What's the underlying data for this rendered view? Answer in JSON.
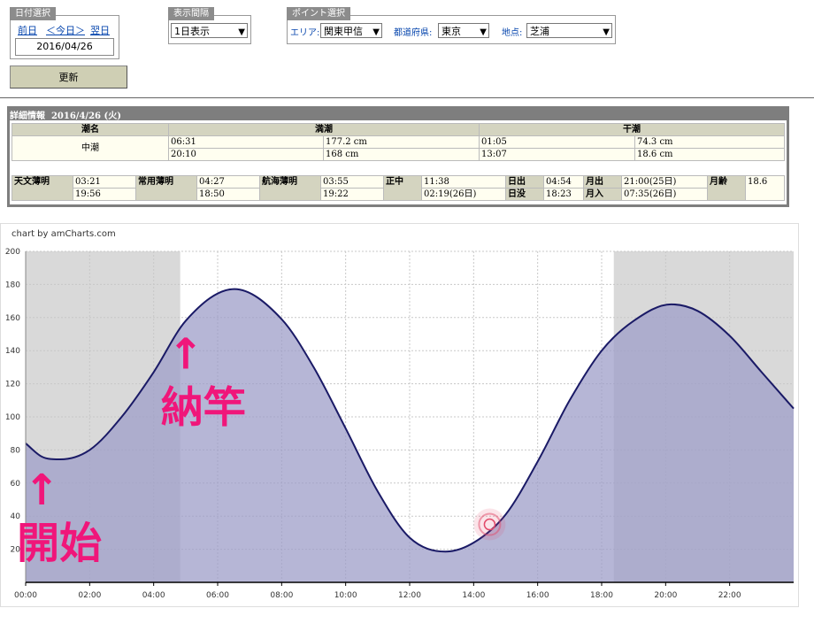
{
  "date_panel": {
    "tab": "日付選択",
    "prev": "前日",
    "today": "＜今日＞",
    "next": "翌日",
    "date": "2016/04/26"
  },
  "interval_panel": {
    "tab": "表示間隔",
    "selected": "1日表示"
  },
  "point_panel": {
    "tab": "ポイント選択",
    "area_label": "エリア:",
    "area_value": "関東甲信",
    "pref_label": "都道府県:",
    "pref_value": "東京",
    "spot_label": "地点:",
    "spot_value": "芝浦"
  },
  "update_button": "更新",
  "detail": {
    "title": "詳細情報",
    "date": "2016/4/26 (火)",
    "tide_name_header": "潮名",
    "high_header": "満潮",
    "low_header": "干潮",
    "tide_name": "中潮",
    "high": [
      {
        "time": "06:31",
        "level": "177.2 cm"
      },
      {
        "time": "20:10",
        "level": "168 cm"
      }
    ],
    "low": [
      {
        "time": "01:05",
        "level": "74.3 cm"
      },
      {
        "time": "13:07",
        "level": "18.6 cm"
      }
    ],
    "twilight": {
      "astro_label": "天文薄明",
      "astro": [
        "03:21",
        "19:56"
      ],
      "civil_label": "常用薄明",
      "civil": [
        "04:27",
        "18:50"
      ],
      "nautical_label": "航海薄明",
      "nautical": [
        "03:55",
        "19:22"
      ],
      "noon_label": "正中",
      "noon": [
        "11:38",
        "02:19(26日)"
      ],
      "sunrise_label": "日出",
      "sunrise": "04:54",
      "sunset_label": "日没",
      "sunset": "18:23",
      "moonrise_label": "月出",
      "moonrise": "21:00(25日)",
      "moonset_label": "月入",
      "moonset": "07:35(26日)",
      "moonage_label": "月齢",
      "moonage": "18.6"
    }
  },
  "chart_data": {
    "type": "area",
    "credit": "chart by amCharts.com",
    "x_unit": "hour",
    "xlim": [
      0,
      24
    ],
    "ylim": [
      0,
      200
    ],
    "ytick_labels": [
      "20",
      "40",
      "60",
      "80",
      "100",
      "120",
      "140",
      "160",
      "180",
      "200"
    ],
    "xtick_labels": [
      "00:00",
      "02:00",
      "04:00",
      "06:00",
      "08:00",
      "10:00",
      "12:00",
      "14:00",
      "16:00",
      "18:00",
      "20:00",
      "22:00"
    ],
    "grid": true,
    "night_shading": [
      [
        0,
        4.83
      ],
      [
        18.38,
        24
      ]
    ],
    "series": [
      {
        "x": [
          0,
          0.5,
          1.08,
          2,
          3,
          4,
          5,
          6.52,
          8,
          9,
          10,
          11,
          12,
          13.12,
          14,
          15,
          16,
          17,
          18,
          19,
          20.17,
          21,
          22,
          23,
          24
        ],
        "values": [
          84,
          76,
          74.3,
          80,
          100,
          127,
          158,
          177.2,
          159,
          130,
          93,
          55,
          27,
          18.6,
          24,
          41,
          73,
          110,
          140,
          158,
          168,
          164,
          149,
          127,
          105
        ],
        "line_color": "#1a1a66",
        "fill_color": "#9d9dc8"
      }
    ],
    "marker": {
      "x": 14.5,
      "y": 35,
      "color": "#e24a6a"
    },
    "annotations": [
      {
        "text": "開始",
        "arrow": "↑",
        "x": 0.5,
        "y": 75,
        "color": "#f0167a"
      },
      {
        "text": "納竿",
        "arrow": "↑",
        "x": 5,
        "y": 157,
        "color": "#f0167a"
      }
    ]
  }
}
